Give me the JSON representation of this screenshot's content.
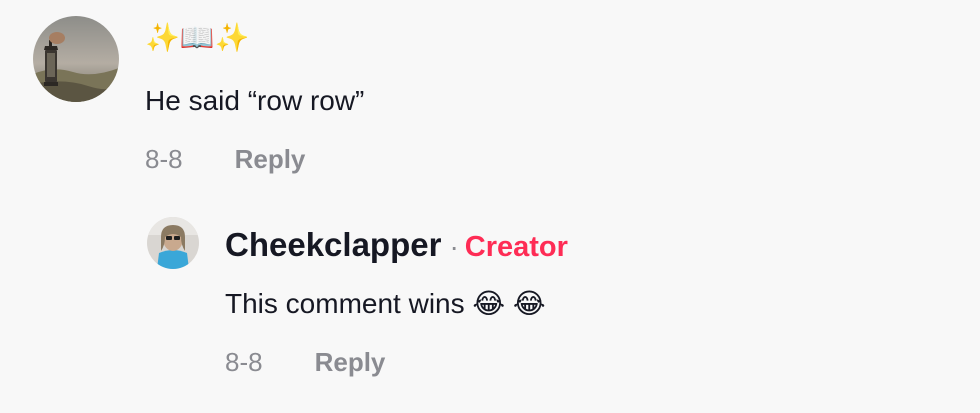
{
  "comment": {
    "username": "✨📖✨",
    "text": "He said “row row”",
    "date": "8-8",
    "reply_label": "Reply"
  },
  "reply": {
    "username": "Cheekclapper",
    "separator": "·",
    "badge": "Creator",
    "text": "This comment wins 😂 😂",
    "date": "8-8",
    "reply_label": "Reply"
  },
  "colors": {
    "background": "#f8f8f8",
    "text": "#161823",
    "muted": "#8a8b91",
    "creator_badge": "#fe2c55"
  }
}
